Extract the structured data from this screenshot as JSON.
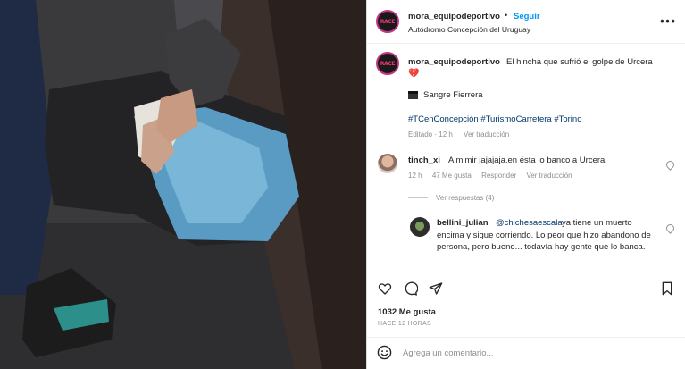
{
  "post": {
    "username": "mora_equipodeportivo",
    "follow_label": "Seguir",
    "dot": "•",
    "location": "Autódromo Concepción del Uruguay",
    "avatar_logo": "RACE",
    "more_icon": "more-icon"
  },
  "caption": {
    "username": "mora_equipodeportivo",
    "text": "El hincha que sufrió el golpe de Urcera",
    "emoji": "💔",
    "line2": "Sangre Fierrera",
    "hashtags": "#TCenConcepción #TurismoCarretera #Torino",
    "edited": "Editado · 12 h",
    "translate": "Ver traducción"
  },
  "comments": [
    {
      "username": "tinch_xi",
      "text": "A mimir jajajaja.en ésta lo banco a Urcera",
      "time": "12 h",
      "likes": "47 Me gusta",
      "reply": "Responder",
      "translate": "Ver traducción"
    }
  ],
  "replies_toggle": "Ver respuestas (4)",
  "reply": {
    "username": "bellini_julian",
    "mention": "@chichesaescala",
    "first_line_rest": "ya tiene un muerto",
    "body": "encima y sigue corriendo. Lo peor que hizo abandono de persona, pero bueno... todavía hay gente que lo banca."
  },
  "footer": {
    "likes": "1032 Me gusta",
    "time_ago": "HACE 12 HORAS",
    "comment_placeholder": "Agrega un comentario..."
  },
  "colors": {
    "link_blue": "#0095f6",
    "hashtag": "#00376b",
    "muted": "#8e8e8e"
  }
}
